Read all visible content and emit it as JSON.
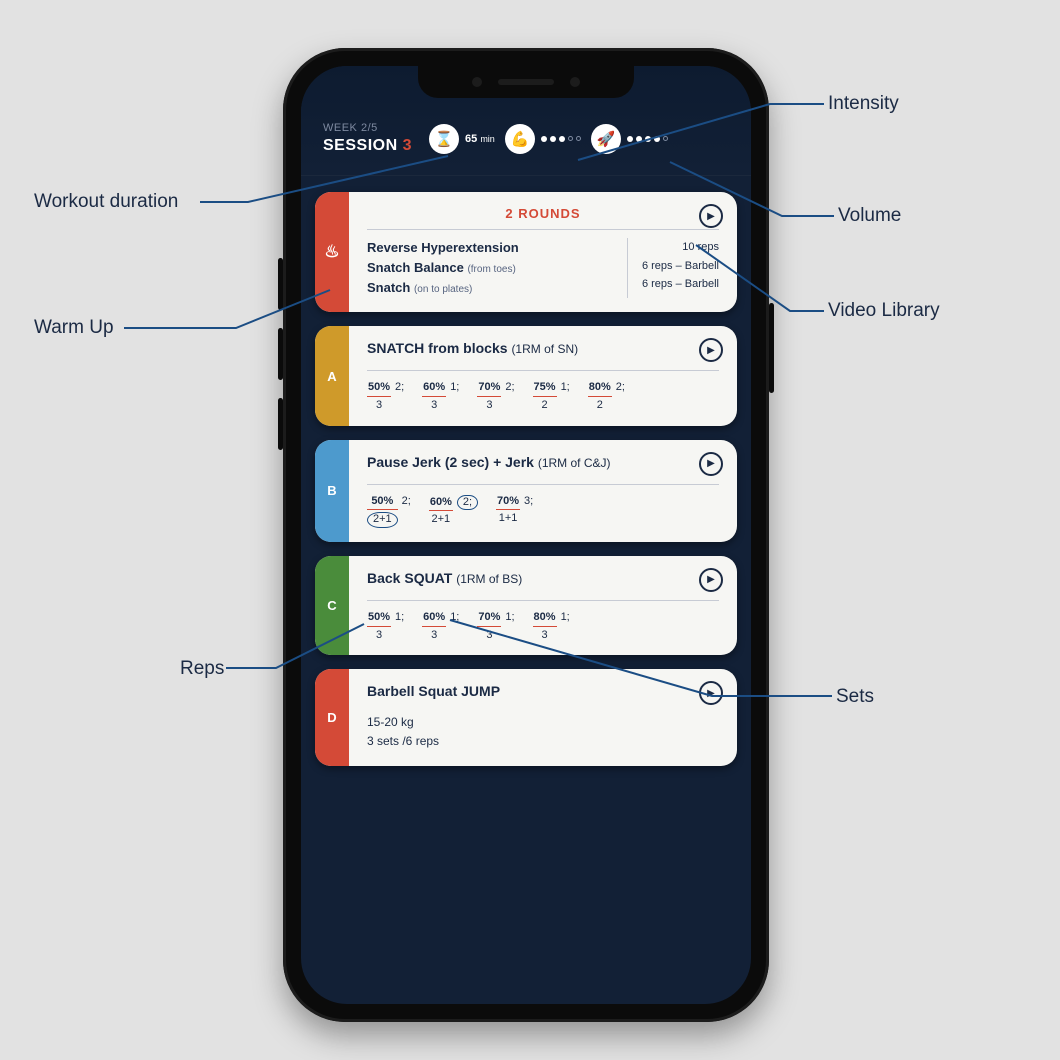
{
  "header": {
    "week_label": "WEEK 2/5",
    "session_label": "SESSION",
    "session_number": "3",
    "duration_value": "65",
    "duration_unit": "min",
    "intensity_filled": 3,
    "intensity_total": 5,
    "volume_filled": 4,
    "volume_total": 5
  },
  "annotations": {
    "intensity": "Intensity",
    "volume": "Volume",
    "video_library": "Video Library",
    "workout_duration": "Workout duration",
    "warm_up": "Warm Up",
    "reps": "Reps",
    "sets": "Sets"
  },
  "warmup": {
    "rounds": "2 ROUNDS",
    "exercises": [
      {
        "name": "Reverse Hyperextension",
        "sub": "",
        "right": "10 reps"
      },
      {
        "name": "Snatch Balance",
        "sub": "(from toes)",
        "right": "6 reps – Barbell"
      },
      {
        "name": "Snatch",
        "sub": "(on to plates)",
        "right": "6 reps – Barbell"
      }
    ]
  },
  "blocks": [
    {
      "tag": "A",
      "color": "#cf9a2a",
      "title": "SNATCH from blocks",
      "note": "(1RM of SN)",
      "sets": [
        {
          "pct": "50%",
          "bot": "3",
          "n": "2;"
        },
        {
          "pct": "60%",
          "bot": "3",
          "n": "1;"
        },
        {
          "pct": "70%",
          "bot": "3",
          "n": "2;"
        },
        {
          "pct": "75%",
          "bot": "2",
          "n": "1;"
        },
        {
          "pct": "80%",
          "bot": "2",
          "n": "2;"
        }
      ]
    },
    {
      "tag": "B",
      "color": "#4d9acd",
      "title": "Pause Jerk (2 sec) + Jerk",
      "note": "(1RM of C&J)",
      "sets": [
        {
          "pct": "50%",
          "bot": "2+1",
          "n": "2;",
          "circle_bot": true
        },
        {
          "pct": "60%",
          "bot": "2+1",
          "n": "2;",
          "circle_n": true
        },
        {
          "pct": "70%",
          "bot": "1+1",
          "n": "3;"
        }
      ]
    },
    {
      "tag": "C",
      "color": "#4a8c3b",
      "title": "Back SQUAT",
      "note": "(1RM of BS)",
      "sets": [
        {
          "pct": "50%",
          "bot": "3",
          "n": "1;"
        },
        {
          "pct": "60%",
          "bot": "3",
          "n": "1;"
        },
        {
          "pct": "70%",
          "bot": "3",
          "n": "1;"
        },
        {
          "pct": "80%",
          "bot": "3",
          "n": "1;"
        }
      ]
    },
    {
      "tag": "D",
      "color": "#d44a37",
      "title": "Barbell Squat JUMP",
      "note": "",
      "simple": [
        "15-20 kg",
        "3 sets /6 reps"
      ]
    }
  ],
  "colors": {
    "warmup_tab": "#d44a37"
  }
}
